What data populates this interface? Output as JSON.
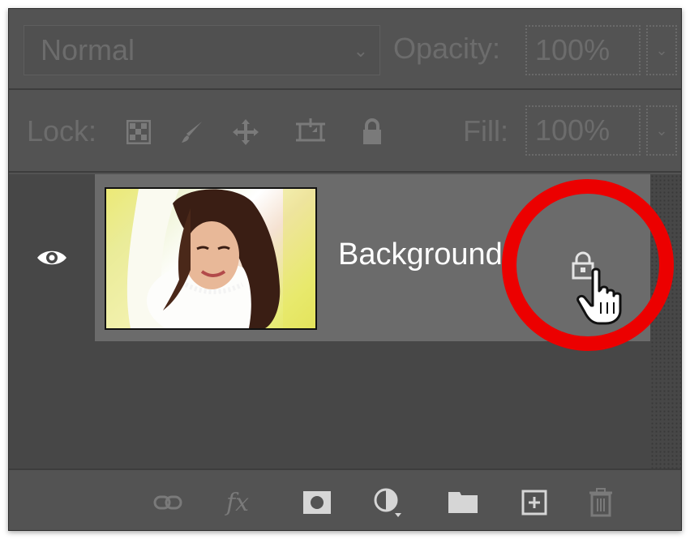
{
  "blend_mode": {
    "value": "Normal"
  },
  "opacity": {
    "label": "Opacity:",
    "value": "100%"
  },
  "lock": {
    "label": "Lock:",
    "icons": [
      "lock-transparent-pixels-icon",
      "lock-image-pixels-icon",
      "lock-position-icon",
      "lock-artboard-icon",
      "lock-all-icon"
    ]
  },
  "fill": {
    "label": "Fill:",
    "value": "100%"
  },
  "layer": {
    "name": "Background",
    "visible": true,
    "locked": true
  },
  "annotation": {
    "ring_color": "#ec0000"
  },
  "bottom_bar": {
    "icons": [
      "link-layers-icon",
      "fx-icon",
      "add-mask-icon",
      "adjustment-layer-icon",
      "new-group-icon",
      "new-layer-icon",
      "delete-icon"
    ],
    "fx_text": "fx"
  },
  "colors": {
    "panel": "#535353",
    "layer_selected": "#6b6b6b",
    "layers_bg": "#474747",
    "text_dim": "#6c6c6c",
    "text_bright": "#ffffff"
  }
}
